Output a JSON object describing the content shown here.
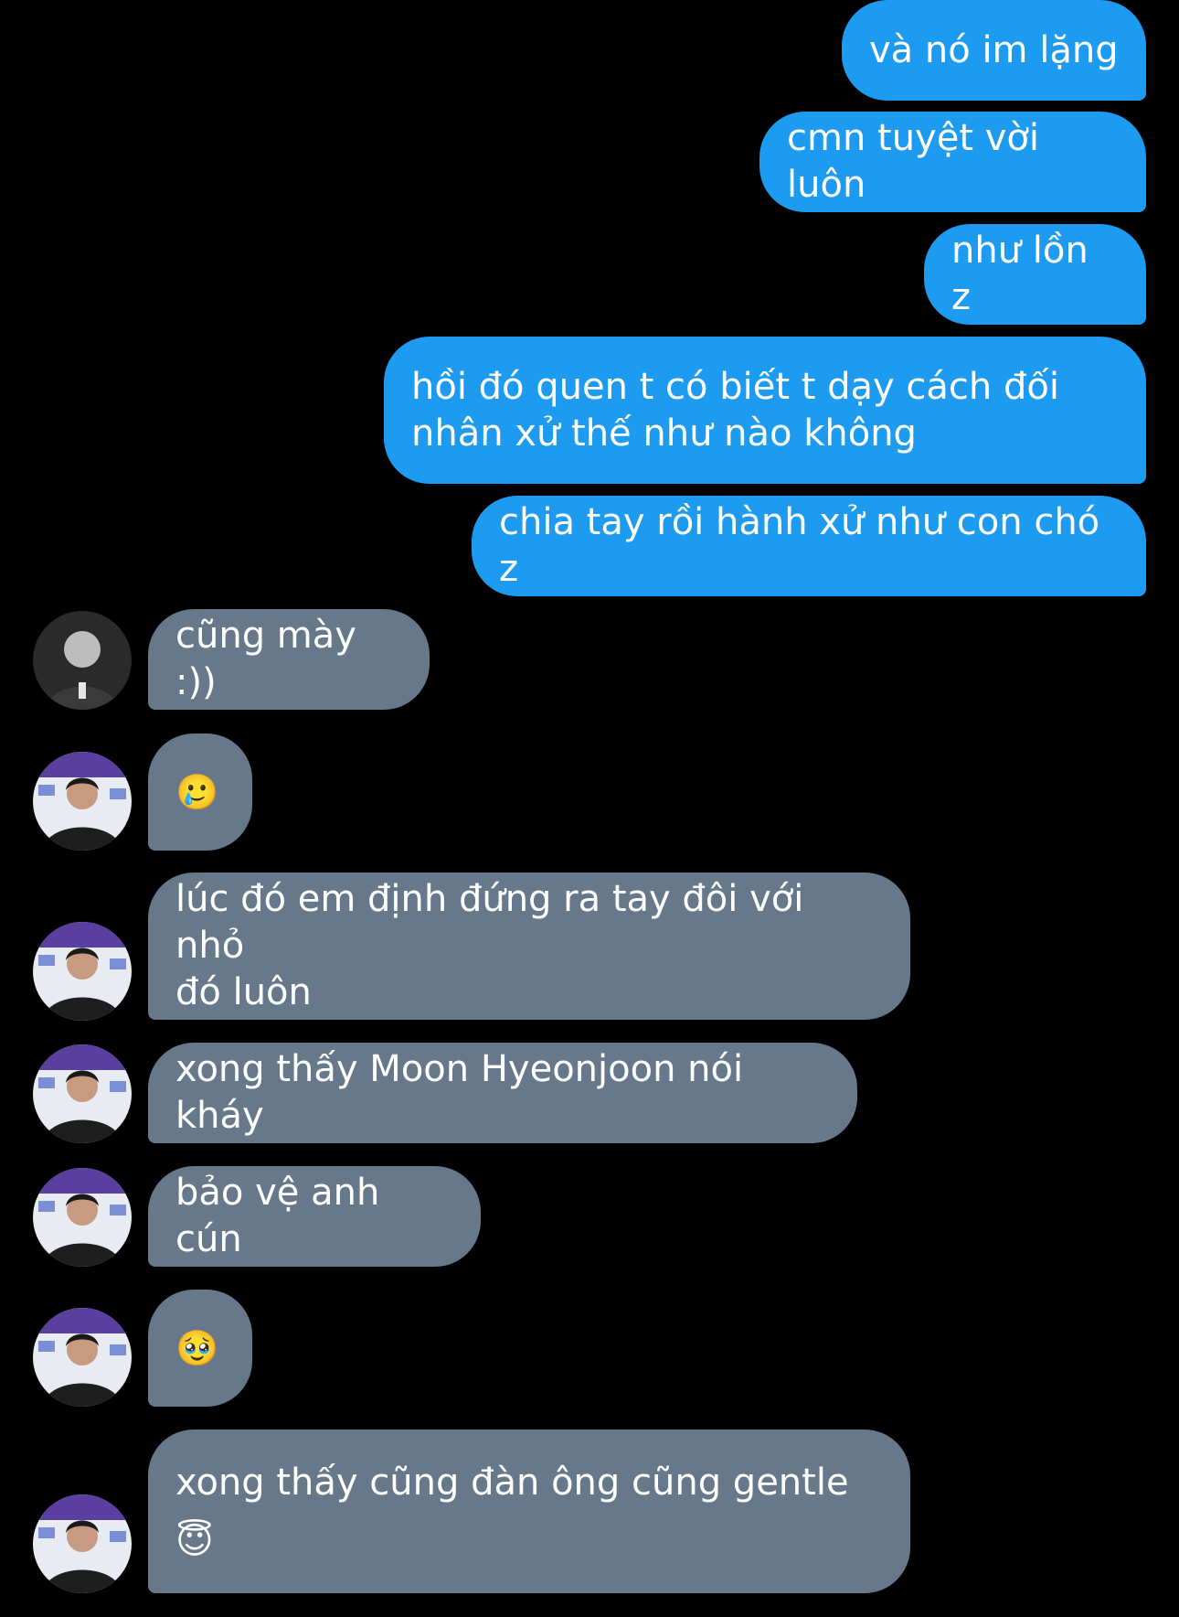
{
  "colors": {
    "background": "#000000",
    "outgoing_bubble": "#1d9bf0",
    "incoming_bubble": "#66788a",
    "text": "#ffffff"
  },
  "messages": [
    {
      "direction": "outgoing",
      "text": "và nó im lặng"
    },
    {
      "direction": "outgoing",
      "text": "cmn tuyệt vời luôn"
    },
    {
      "direction": "outgoing",
      "text": "như lồn z"
    },
    {
      "direction": "outgoing",
      "text": "hồi đó quen t có biết t dạy cách đối\nnhân xử thế như nào không"
    },
    {
      "direction": "outgoing",
      "text": "chia tay rồi hành xử như con chó z"
    },
    {
      "direction": "incoming",
      "avatar": "grayscale-photo-avatar",
      "text": "cũng mày :))"
    },
    {
      "direction": "incoming",
      "avatar": "interview-photo-avatar",
      "text": "🥲"
    },
    {
      "direction": "incoming",
      "avatar": "interview-photo-avatar",
      "text": "lúc đó em định đứng ra tay đôi với nhỏ\nđó luôn"
    },
    {
      "direction": "incoming",
      "avatar": "interview-photo-avatar",
      "text": "xong thấy Moon Hyeonjoon nói kháy"
    },
    {
      "direction": "incoming",
      "avatar": "interview-photo-avatar",
      "text": "bảo vệ anh cún"
    },
    {
      "direction": "incoming",
      "avatar": "interview-photo-avatar",
      "text": "🥹"
    },
    {
      "direction": "incoming",
      "avatar": "interview-photo-avatar",
      "text": "xong thấy cũng đàn ông cũng gentle\n😇"
    }
  ]
}
